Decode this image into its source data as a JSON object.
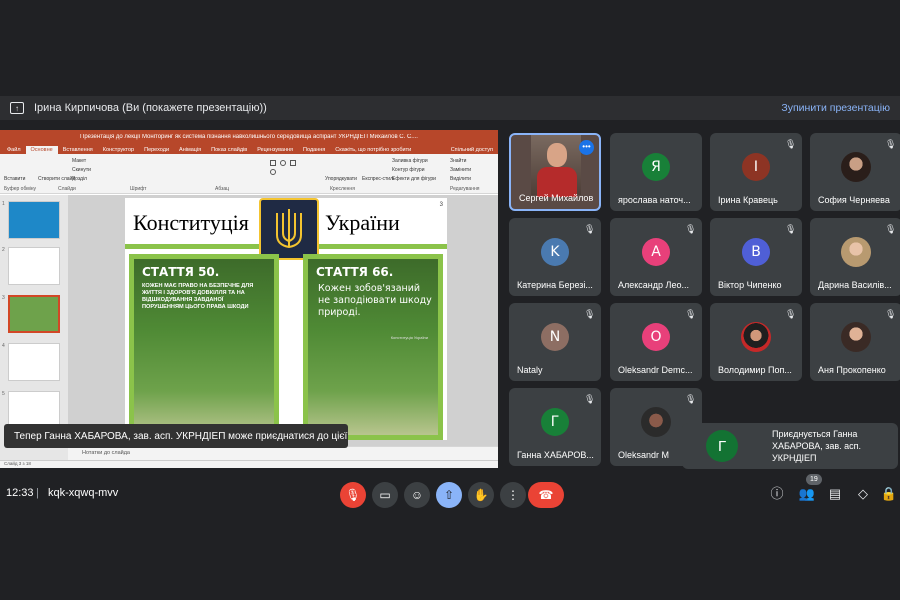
{
  "presenter_bar": {
    "presenter_name": "Ірина Кирпичова (Ви (покажете презентацію))",
    "stop_label": "Зупинити презентацію"
  },
  "ppt": {
    "window_title": "Презентація до лекції Моніторинг як система пізнання навколишнього середовища аспірант УКРНДІЕП Михайлов С. С....",
    "tabs": [
      "Файл",
      "Основне",
      "Вставлення",
      "Конструктор",
      "Переходи",
      "Анімація",
      "Показ слайдів",
      "Рецензування",
      "Подання",
      "Скажіть, що потрібно зробити"
    ],
    "share_label": "Спільний доступ",
    "ribbon": {
      "paste": "Вставити",
      "create_slide": "Створити слайд",
      "layout": "Макет",
      "reset": "Скинути",
      "sections": "Розділ",
      "clipboard_group": "Буфер обміну",
      "slides_group": "Слайди",
      "font_group": "Шрифт",
      "paragraph_group": "Абзац",
      "drawing_group": "Креслення",
      "editing_group": "Редагування",
      "arrange": "Упорядкувати",
      "quick_styles": "Експрес-стилі",
      "fill": "Заливка фігури",
      "outline": "Контур фігури",
      "effects": "Ефекти для фігури",
      "find": "Знайти",
      "replace": "Замінити",
      "select": "Виділити"
    },
    "thumb_numbers": [
      "1",
      "2",
      "3",
      "4",
      "5"
    ],
    "slide": {
      "number": "3",
      "heading_left": "Конституція",
      "heading_right": "України",
      "card1_title": "СТАТТЯ 50.",
      "card1_text": "КОЖЕН МАЄ ПРАВО НА БЕЗПЕЧНЕ ДЛЯ ЖИТТЯ І ЗДОРОВ'Я ДОВКІЛЛЯ ТА НА ВІДШКОДУВАННЯ ЗАВДАНОЇ ПОРУШЕННЯМ ЦЬОГО ПРАВА ШКОДИ",
      "card2_title": "СТАТТЯ 66.",
      "card2_text": "Кожен зобов'язаний не заподіювати шкоду природі.",
      "card2_source": "Конституція України"
    },
    "notes_label": "Нотатки до слайда",
    "status_text": "Слайд 3 з 18"
  },
  "participants": [
    {
      "name": "Сергей Михайлов",
      "type": "video"
    },
    {
      "name": "ярослава наточ...",
      "initial": "Я",
      "color": "#188038",
      "muted": false
    },
    {
      "name": "Ірина Кравець",
      "initial": "І",
      "color": "#8d3424",
      "muted": true
    },
    {
      "name": "София Черняева",
      "type": "photo",
      "muted": true
    },
    {
      "name": "Катерина Березі...",
      "initial": "K",
      "color": "#4a7ab0",
      "muted": true
    },
    {
      "name": "Александр Лео...",
      "initial": "А",
      "color": "#e8407a",
      "muted": true
    },
    {
      "name": "Віктор Чипенко",
      "initial": "В",
      "color": "#4f5fd6",
      "muted": true
    },
    {
      "name": "Дарина Василів...",
      "type": "photo",
      "muted": true
    },
    {
      "name": "Nataly",
      "initial": "N",
      "color": "#8d6e63",
      "muted": true
    },
    {
      "name": "Oleksandr Demc...",
      "initial": "O",
      "color": "#e8407a",
      "muted": true
    },
    {
      "name": "Володимир Поп...",
      "type": "photo",
      "muted": true
    },
    {
      "name": "Аня Прокопенко",
      "type": "photo",
      "muted": true
    },
    {
      "name": "Ганна ХАБАРОВ...",
      "initial": "Г",
      "color": "#188038",
      "muted": true
    },
    {
      "name": "Oleksandr M",
      "type": "photo",
      "muted": true
    }
  ],
  "toast": {
    "text": "Тепер Ганна ХАБАРОВА, зав. асп. УКРНДІЕП може приєднатися до цієї зустрічі."
  },
  "join_popup": {
    "initial": "Г",
    "text": "Приєднується Ганна ХАБАРОВА, зав. асп. УКРНДІЕП"
  },
  "bottom_bar": {
    "time": "12:33",
    "separator": "|",
    "meeting_code": "kqk-xqwq-mvv",
    "participants_count": "19"
  },
  "colors": {
    "accent": "#8ab4f8",
    "danger": "#ea4335",
    "ppt_brand": "#b7472a",
    "slide_green": "#8bc34a"
  }
}
